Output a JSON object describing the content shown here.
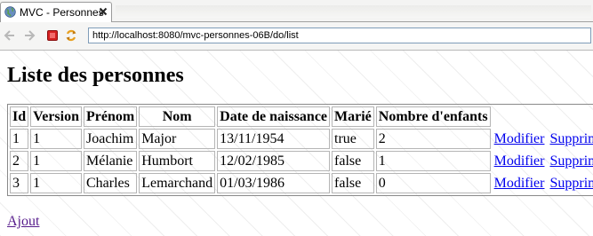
{
  "tab": {
    "title": "MVC - Personnes",
    "icon": "globe-icon",
    "close_icon": "close-icon"
  },
  "toolbar": {
    "back_icon": "back-arrow-icon",
    "forward_icon": "forward-arrow-icon",
    "stop_icon": "stop-icon",
    "refresh_icon": "refresh-icon",
    "url": "http://localhost:8080/mvc-personnes-06B/do/list"
  },
  "page": {
    "title": "Liste des personnes",
    "add_link": "Ajout"
  },
  "table": {
    "headers": [
      "Id",
      "Version",
      "Prénom",
      "Nom",
      "Date de naissance",
      "Marié",
      "Nombre d'enfants"
    ],
    "rows": [
      {
        "id": "1",
        "version": "1",
        "prenom": "Joachim",
        "nom": "Major",
        "date": "13/11/1954",
        "marie": "true",
        "enfants": "2",
        "edit": "Modifier",
        "delete": "Supprimer"
      },
      {
        "id": "2",
        "version": "1",
        "prenom": "Mélanie",
        "nom": "Humbort",
        "date": "12/02/1985",
        "marie": "false",
        "enfants": "1",
        "edit": "Modifier",
        "delete": "Supprimer"
      },
      {
        "id": "3",
        "version": "1",
        "prenom": "Charles",
        "nom": "Lemarchand",
        "date": "01/03/1986",
        "marie": "false",
        "enfants": "0",
        "edit": "Modifier",
        "delete": "Supprimer"
      }
    ]
  },
  "colors": {
    "link": "#0000ee",
    "visited_link": "#551a8b",
    "stop_red": "#d42020",
    "refresh_orange": "#e8a020"
  }
}
